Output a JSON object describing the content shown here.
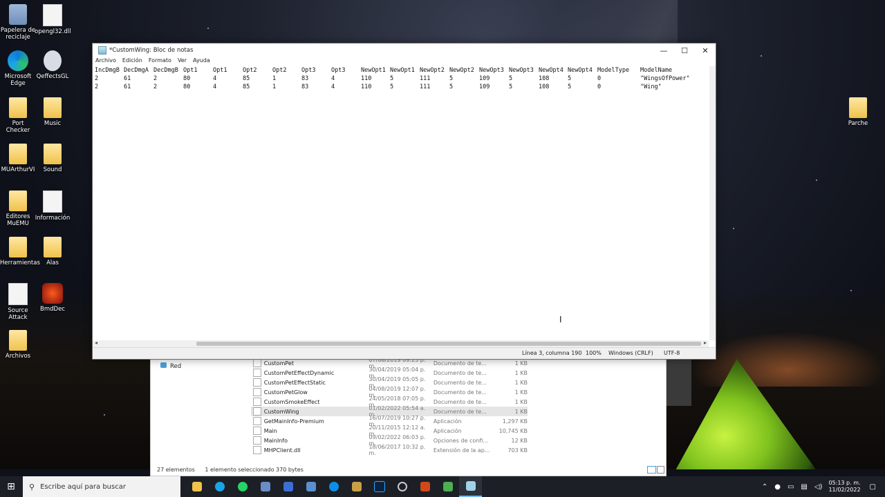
{
  "desktop_icons": {
    "recycle_bin": "Papelera de reciclaje",
    "opengl": "opengl32.dll",
    "edge": "Microsoft Edge",
    "qeffects": "QeffectsGL",
    "port_checker": "Port Checker",
    "music": "Music",
    "muarthur": "MUArthurVI",
    "sound": "Sound",
    "editores": "Editores MuEMU",
    "informacion": "Información",
    "herramientas": "Herramientas",
    "alas": "Alas",
    "source_attack": "Source Attack",
    "bmddec": "BmdDec",
    "archivos": "Archivos",
    "parche": "Parche"
  },
  "notepad": {
    "title": "*CustomWing: Bloc de notas",
    "minimize": "—",
    "maximize": "☐",
    "close": "✕",
    "menu": [
      "Archivo",
      "Edición",
      "Formato",
      "Ver",
      "Ayuda"
    ],
    "columns": [
      "IncDmgB",
      "DecDmgA",
      "DecDmgB",
      "Opt1",
      "Opt1",
      "Opt2",
      "Opt2",
      "Opt3",
      "Opt3",
      "NewOpt1",
      "NewOpt1",
      "NewOpt2",
      "NewOpt2",
      "NewOpt3",
      "NewOpt3",
      "NewOpt4",
      "NewOpt4",
      "ModelType",
      "ModelName"
    ],
    "rows": [
      [
        "2",
        "61",
        "2",
        "80",
        "4",
        "85",
        "1",
        "83",
        "4",
        "110",
        "5",
        "111",
        "5",
        "109",
        "5",
        "108",
        "5",
        "0",
        "\"WingsOfPower\""
      ],
      [
        "2",
        "61",
        "2",
        "80",
        "4",
        "85",
        "1",
        "83",
        "4",
        "110",
        "5",
        "111",
        "5",
        "109",
        "5",
        "108",
        "5",
        "0",
        "\"Wing\""
      ]
    ],
    "status": {
      "position": "Línea 3, columna 190",
      "zoom": "100%",
      "line_ending": "Windows (CRLF)",
      "encoding": "UTF-8"
    }
  },
  "explorer": {
    "nav_item": "Red",
    "files": [
      {
        "name": "CustomPet",
        "date": "07/08/2019 09:25 p. m.",
        "type": "Documento de te...",
        "size": "1 KB"
      },
      {
        "name": "CustomPetEffectDynamic",
        "date": "30/04/2019 05:04 p. m.",
        "type": "Documento de te...",
        "size": "1 KB"
      },
      {
        "name": "CustomPetEffectStatic",
        "date": "30/04/2019 05:05 p. m.",
        "type": "Documento de te...",
        "size": "1 KB"
      },
      {
        "name": "CustomPetGlow",
        "date": "04/08/2019 12:07 p. m.",
        "type": "Documento de te...",
        "size": "1 KB"
      },
      {
        "name": "CustomSmokeEffect",
        "date": "24/05/2018 07:05 p. m.",
        "type": "Documento de te...",
        "size": "1 KB"
      },
      {
        "name": "CustomWing",
        "date": "01/02/2022 05:54 a. m.",
        "type": "Documento de te...",
        "size": "1 KB"
      },
      {
        "name": "GetMainInfo-Premium",
        "date": "16/07/2019 10:27 p. m.",
        "type": "Aplicación",
        "size": "1,297 KB"
      },
      {
        "name": "Main",
        "date": "20/11/2015 12:12 a. m.",
        "type": "Aplicación",
        "size": "10,745 KB"
      },
      {
        "name": "MainInfo",
        "date": "09/02/2022 06:03 p. m.",
        "type": "Opciones de confi...",
        "size": "12 KB"
      },
      {
        "name": "MHPClient.dll",
        "date": "18/06/2017 10:32 p. m.",
        "type": "Extensión de la ap...",
        "size": "703 KB"
      }
    ],
    "status_count": "27 elementos",
    "status_selected": "1 elemento seleccionado  370 bytes"
  },
  "taskbar": {
    "search_placeholder": "Escribe aquí para buscar",
    "time": "05:13 p. m.",
    "date": "11/02/2022"
  }
}
